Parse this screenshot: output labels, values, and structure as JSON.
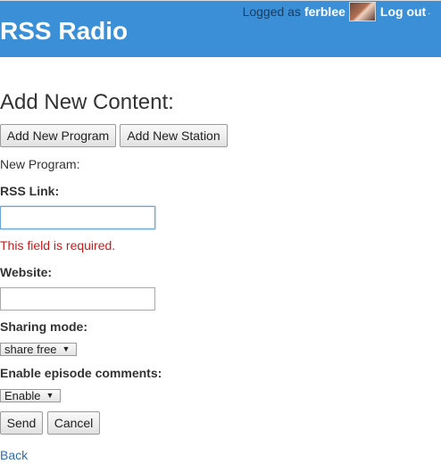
{
  "header": {
    "app_title": "RSS Radio",
    "logged_as_prefix": "Logged as",
    "username": "ferblee",
    "logout_label": "Log out",
    "separator": "."
  },
  "content": {
    "section_title": "Add New Content:",
    "add_program_label": "Add New Program",
    "add_station_label": "Add New Station",
    "form_heading": "New Program:"
  },
  "form": {
    "rss_link": {
      "label": "RSS Link:",
      "value": "",
      "error": "This field is required."
    },
    "website": {
      "label": "Website:",
      "value": ""
    },
    "sharing_mode": {
      "label": "Sharing mode:",
      "selected": "share free"
    },
    "episode_comments": {
      "label": "Enable episode comments:",
      "selected": "Enable"
    },
    "send_label": "Send",
    "cancel_label": "Cancel",
    "back_label": "Back"
  },
  "colors": {
    "header_bg": "#3a8fd6",
    "error": "#cc1a1a",
    "link": "#2a6eb8"
  }
}
